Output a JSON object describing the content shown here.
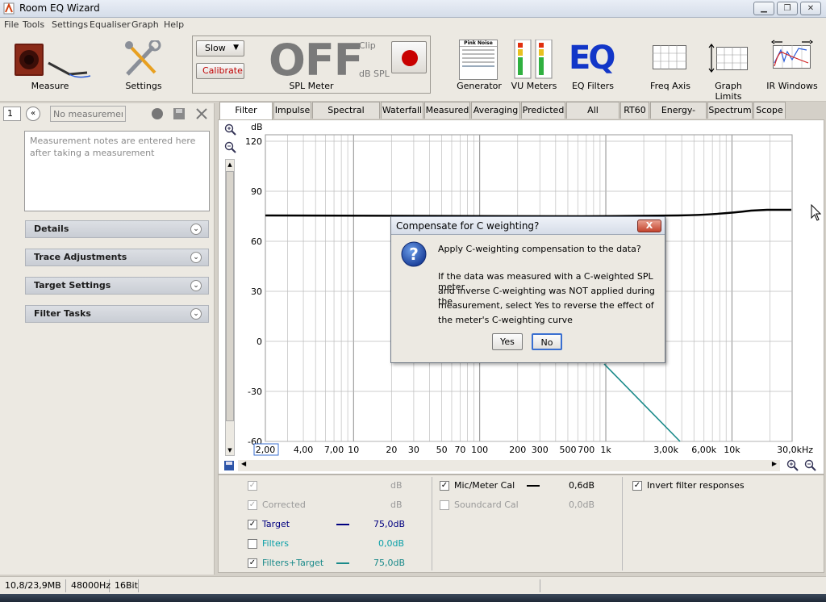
{
  "window": {
    "title": "Room EQ Wizard"
  },
  "menu": [
    "File",
    "Tools",
    "Settings",
    "Equaliser",
    "Graph",
    "Help"
  ],
  "toolbar": {
    "measure_label": "Measure",
    "settings_label": "Settings",
    "spl": {
      "speed": "Slow",
      "calibrate": "Calibrate",
      "display": "OFF",
      "clip": "Clip",
      "unit": "dB SPL",
      "label": "SPL Meter"
    },
    "generator_label": "Generator",
    "generator_mini": "Pink Noise",
    "vu_label": "VU Meters",
    "eq_label": "EQ Filters",
    "freq_axis_label": "Freq Axis",
    "graph_limits_label": "Graph Limits",
    "ir_windows_label": "IR Windows"
  },
  "left_panel": {
    "measurement_index": "1",
    "measurement_name_placeholder": "No measurement",
    "notes_placeholder": "Measurement notes are entered here after taking a measurement",
    "sections": [
      "Details",
      "Trace Adjustments",
      "Target Settings",
      "Filter Tasks"
    ]
  },
  "tabs": [
    "Filter Adjust",
    "Impulse",
    "Spectral Decay",
    "Waterfall",
    "Measured",
    "Averaging",
    "Predicted",
    "All Impulses",
    "RT60",
    "Energy-Time",
    "Spectrum",
    "Scope"
  ],
  "graph": {
    "y_unit": "dB",
    "y_ticks": [
      "120",
      "90",
      "60",
      "30",
      "0",
      "-30",
      "-60"
    ],
    "x_ticks": [
      "2,00",
      "4,00",
      "7,00",
      "10",
      "20",
      "30",
      "50",
      "70",
      "100",
      "200",
      "300",
      "500",
      "700",
      "1k",
      "3,00k",
      "6,00k",
      "10k",
      "30,0kHz"
    ]
  },
  "legend": {
    "left": [
      {
        "label": "",
        "value": "dB",
        "checked": true,
        "enabled": false
      },
      {
        "label": "Corrected",
        "value": "dB",
        "checked": true,
        "enabled": false
      },
      {
        "label": "Target",
        "value": "75,0dB",
        "checked": true,
        "enabled": true
      },
      {
        "label": "Filters",
        "value": "0,0dB",
        "checked": false,
        "enabled": true
      },
      {
        "label": "Filters+Target",
        "value": "75,0dB",
        "checked": true,
        "enabled": true
      }
    ],
    "middle": [
      {
        "label": "Mic/Meter Cal",
        "value": "0,6dB",
        "checked": true
      },
      {
        "label": "Soundcard Cal",
        "value": "0,0dB",
        "checked": false
      }
    ],
    "right": {
      "label": "Invert filter responses",
      "checked": true
    }
  },
  "dialog": {
    "title": "Compensate for C weighting?",
    "question": "Apply C-weighting compensation to the data?",
    "body_lines": [
      "If the data was measured with a C-weighted SPL meter",
      "and inverse C-weighting was NOT applied during the",
      "measurement, select Yes to reverse the effect of",
      "the meter's C-weighting curve"
    ],
    "yes": "Yes",
    "no": "No",
    "close": "X"
  },
  "status": {
    "memory": "10,8/23,9MB",
    "rate": "48000Hz",
    "bits": "16Bit"
  },
  "colors": {
    "target": "#000080",
    "filters": "#0ba0a8",
    "filters_target": "#1a8a8a",
    "calibrate": "#c00000"
  }
}
